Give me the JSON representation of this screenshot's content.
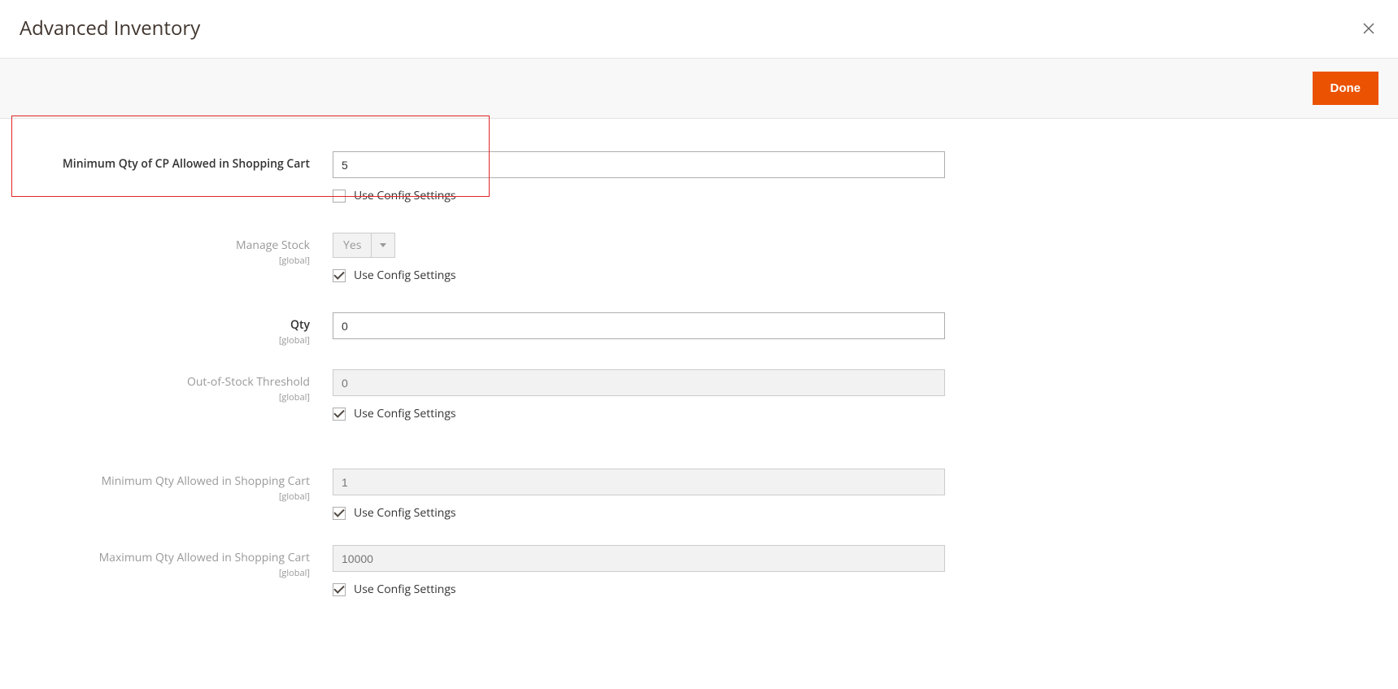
{
  "header": {
    "title": "Advanced Inventory"
  },
  "actions": {
    "done_label": "Done"
  },
  "fields": {
    "min_cp_qty": {
      "label": "Minimum Qty of CP Allowed in Shopping Cart",
      "value": "5",
      "use_config_label": "Use Config Settings",
      "use_config_checked": false
    },
    "manage_stock": {
      "label": "Manage Stock",
      "scope": "[global]",
      "value": "Yes",
      "use_config_label": "Use Config Settings",
      "use_config_checked": true
    },
    "qty": {
      "label": "Qty",
      "scope": "[global]",
      "value": "0"
    },
    "out_of_stock_threshold": {
      "label": "Out-of-Stock Threshold",
      "scope": "[global]",
      "placeholder": "0",
      "use_config_label": "Use Config Settings",
      "use_config_checked": true
    },
    "min_qty": {
      "label": "Minimum Qty Allowed in Shopping Cart",
      "scope": "[global]",
      "placeholder": "1",
      "use_config_label": "Use Config Settings",
      "use_config_checked": true
    },
    "max_qty": {
      "label": "Maximum Qty Allowed in Shopping Cart",
      "scope": "[global]",
      "placeholder": "10000",
      "use_config_label": "Use Config Settings",
      "use_config_checked": true
    }
  }
}
